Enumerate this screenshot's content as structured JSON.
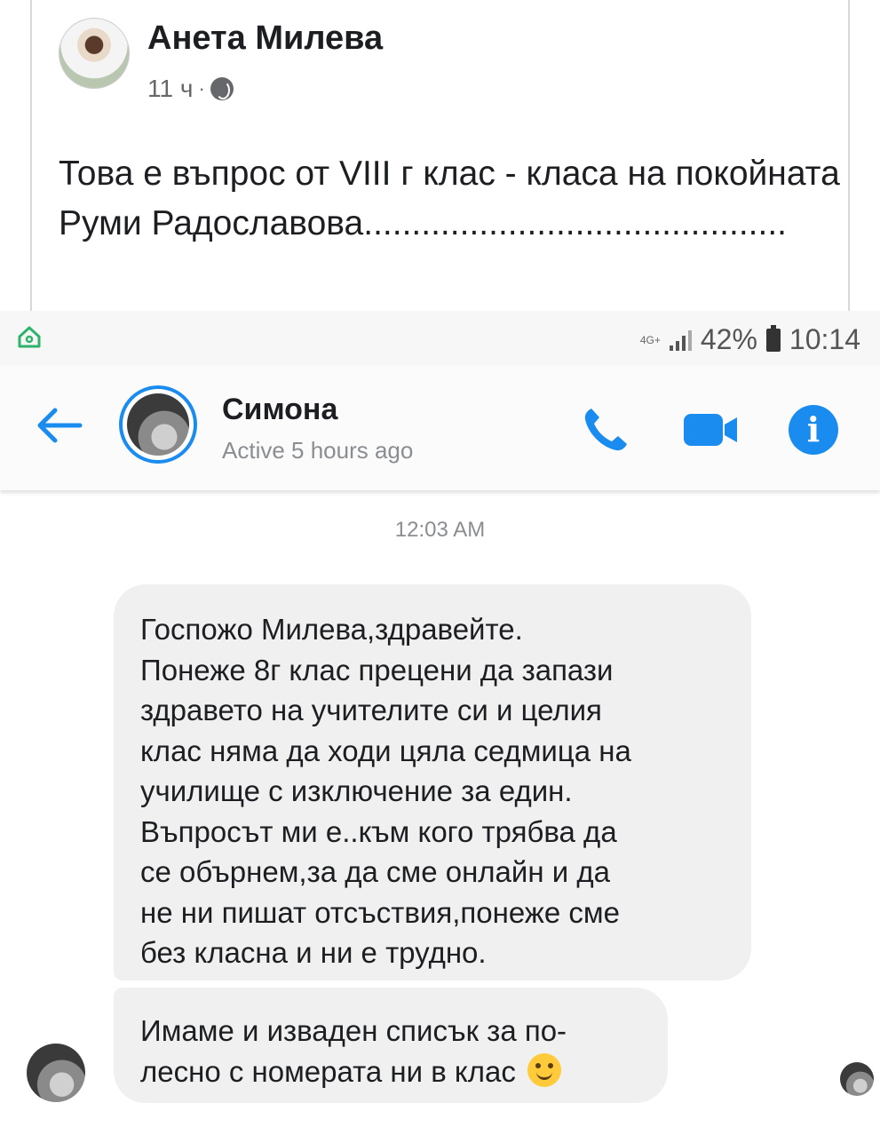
{
  "post": {
    "author": "Анета Милева",
    "time": "11 ч",
    "separator": "·",
    "text": "Това е въпрос от VIII г клас - класа на покойната Руми Радославова............................................"
  },
  "status_bar": {
    "network": "4G+",
    "battery": "42%",
    "clock": "10:14"
  },
  "conversation": {
    "contact_name": "Симона",
    "presence": "Active 5 hours ago",
    "accent_color": "#1a8cf0"
  },
  "messages": {
    "timestamp": "12:03 AM",
    "items": [
      {
        "lines": [
          "Госпожо Милева,здравейте.",
          "Понеже 8г клас прецени да запази",
          "здравето на учителите си и целия",
          "клас няма да ходи цяла седмица на",
          "училище с изключение за един.",
          "Въпросът ми е..към кого трябва да",
          "се обърнем,за да сме онлайн и да",
          "не ни пишат отсъствия,понеже сме",
          "без класна и ни е трудно."
        ]
      },
      {
        "lines": [
          "Имаме и изваден списък за по-",
          "лесно с номерата ни в клас"
        ],
        "emoji": "smiling-face-icon"
      }
    ]
  }
}
